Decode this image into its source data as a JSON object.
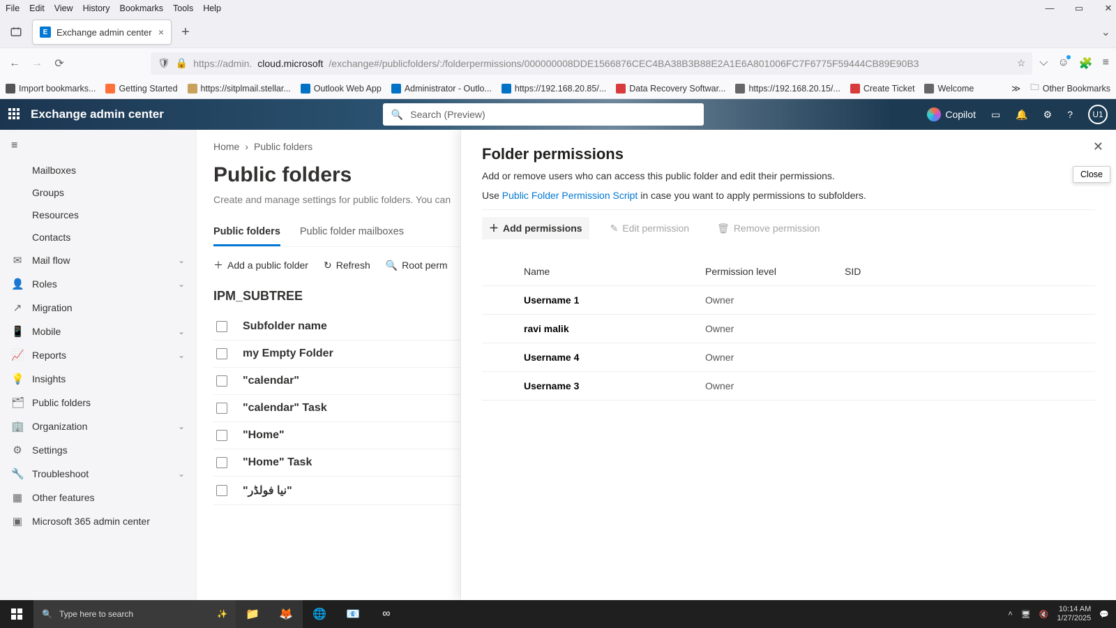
{
  "firefox_menu": [
    "File",
    "Edit",
    "View",
    "History",
    "Bookmarks",
    "Tools",
    "Help"
  ],
  "tab_title": "Exchange admin center",
  "url": {
    "scheme": "https://admin.",
    "host": "cloud.microsoft",
    "path": "/exchange#/publicfolders/:/folderpermissions/000000008DDE1566876CEC4BA38B3B88E2A1E6A801006FC7F6775F59444CB89E90B3"
  },
  "bookmarks": {
    "items": [
      {
        "label": "Import bookmarks...",
        "color": "#555"
      },
      {
        "label": "Getting Started",
        "color": "#ff7139"
      },
      {
        "label": "https://sitplmail.stellar...",
        "color": "#c8a15a"
      },
      {
        "label": "Outlook Web App",
        "color": "#0072c6"
      },
      {
        "label": "Administrator - Outlo...",
        "color": "#0072c6"
      },
      {
        "label": "https://192.168.20.85/...",
        "color": "#0072c6"
      },
      {
        "label": "Data Recovery Softwar...",
        "color": "#d83b3b"
      },
      {
        "label": "https://192.168.20.15/...",
        "color": "#666"
      },
      {
        "label": "Create Ticket",
        "color": "#d83b3b"
      },
      {
        "label": "Welcome",
        "color": "#666"
      }
    ],
    "other": "Other Bookmarks"
  },
  "banner": {
    "title": "Exchange admin center",
    "search_placeholder": "Search (Preview)",
    "copilot": "Copilot",
    "avatar": "U1"
  },
  "leftnav": [
    {
      "label": "Mailboxes",
      "icon": ""
    },
    {
      "label": "Groups",
      "icon": ""
    },
    {
      "label": "Resources",
      "icon": ""
    },
    {
      "label": "Contacts",
      "icon": ""
    },
    {
      "label": "Mail flow",
      "icon": "✉",
      "chev": true
    },
    {
      "label": "Roles",
      "icon": "👤",
      "chev": true
    },
    {
      "label": "Migration",
      "icon": "↗"
    },
    {
      "label": "Mobile",
      "icon": "📱",
      "chev": true
    },
    {
      "label": "Reports",
      "icon": "📈",
      "chev": true
    },
    {
      "label": "Insights",
      "icon": "💡"
    },
    {
      "label": "Public folders",
      "icon": "🗂"
    },
    {
      "label": "Organization",
      "icon": "🏢",
      "chev": true
    },
    {
      "label": "Settings",
      "icon": "⚙"
    },
    {
      "label": "Troubleshoot",
      "icon": "🔧",
      "chev": true
    },
    {
      "label": "Other features",
      "icon": "▦"
    },
    {
      "label": "Microsoft 365 admin center",
      "icon": "▣"
    }
  ],
  "breadcrumbs": [
    "Home",
    "Public folders"
  ],
  "page": {
    "title": "Public folders",
    "subtitle": "Create and manage settings for public folders. You can",
    "tabs": [
      "Public folders",
      "Public folder mailboxes"
    ],
    "active_tab": 0,
    "commands": [
      {
        "icon": "＋",
        "label": "Add a public folder"
      },
      {
        "icon": "↻",
        "label": "Refresh"
      },
      {
        "icon": "🔍",
        "label": "Root perm"
      }
    ],
    "tree_root": "IPM_SUBTREE",
    "col_header": "Subfolder name",
    "rows": [
      "my Empty Folder",
      "\"calendar\"",
      "\"calendar\" Task",
      "\"Home\"",
      "\"Home\" Task",
      "\"نیا فولڈر\""
    ]
  },
  "flyout": {
    "title": "Folder permissions",
    "desc": "Add or remove users who can access this public folder and edit their permissions.",
    "script_prefix": "Use ",
    "script_link": "Public Folder Permission Script",
    "script_suffix": " in case you want to apply permissions to subfolders.",
    "close_label": "Close",
    "buttons": {
      "add": "Add permissions",
      "edit": "Edit permission",
      "remove": "Remove permission"
    },
    "cols": [
      "Name",
      "Permission level",
      "SID"
    ],
    "rows": [
      {
        "name": "Username 1",
        "level": "Owner"
      },
      {
        "name": "ravi malik",
        "level": "Owner"
      },
      {
        "name": "Username 4",
        "level": "Owner"
      },
      {
        "name": "Username 3",
        "level": "Owner"
      }
    ]
  },
  "taskbar": {
    "search_placeholder": "Type here to search",
    "time": "10:14 AM",
    "date": "1/27/2025"
  }
}
